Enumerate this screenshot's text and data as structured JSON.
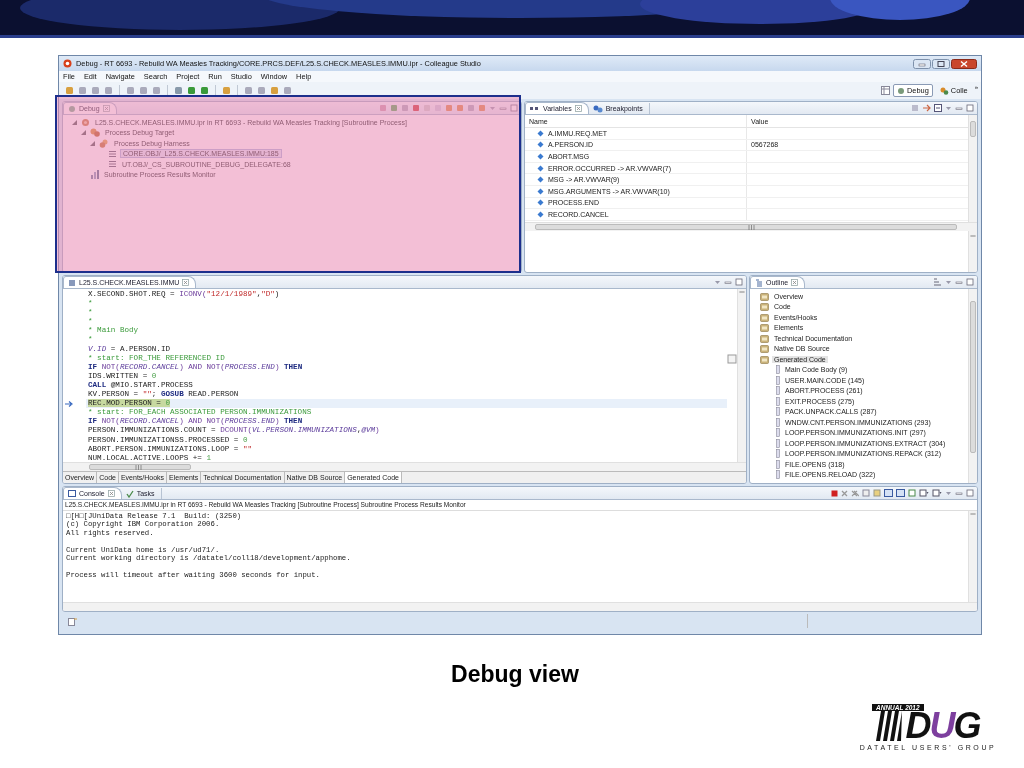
{
  "window": {
    "title": "Debug - RT 6693 - Rebuild WA Measles Tracking/CORE.PRCS.DEF/L25.S.CHECK.MEASLES.IMMU.ipr - Colleague Studio"
  },
  "menu": [
    "File",
    "Edit",
    "Navigate",
    "Search",
    "Project",
    "Run",
    "Studio",
    "Window",
    "Help"
  ],
  "perspectives": [
    {
      "label": "Debug",
      "selected": true
    },
    {
      "label": "Colle",
      "selected": false
    }
  ],
  "perspective_overflow": "»",
  "debug_view": {
    "tab": "Debug",
    "tree": [
      {
        "label": "L25.S.CHECK.MEASLES.IMMU.ipr in RT 6693 - Rebuild WA Measles Tracking [Subroutine Process]",
        "kind": "launch",
        "expanded": true,
        "selected": false,
        "children": [
          {
            "label": "Process Debug Target",
            "kind": "target",
            "expanded": true,
            "selected": false,
            "children": [
              {
                "label": "Process Debug Harness",
                "kind": "harness",
                "expanded": true,
                "selected": false,
                "children": [
                  {
                    "label": "CORE.OBJ/_L25.S.CHECK.MEASLES.IMMU:185",
                    "kind": "frame",
                    "selected": true
                  },
                  {
                    "label": "UT.OBJ/_CS_SUBROUTINE_DEBUG_DELEGATE:68",
                    "kind": "frame",
                    "selected": false
                  }
                ]
              }
            ]
          },
          {
            "label": "Subroutine Process Results Monitor",
            "kind": "monitor",
            "selected": false
          }
        ]
      }
    ]
  },
  "variables_view": {
    "tabs": [
      {
        "label": "Variables",
        "selected": true
      },
      {
        "label": "Breakpoints",
        "selected": false
      }
    ],
    "columns": [
      "Name",
      "Value"
    ],
    "rows": [
      {
        "name": "A.IMMU.REQ.MET"
      },
      {
        "name": "A.PERSON.ID",
        "value": "0567268"
      },
      {
        "name": "ABORT.MSG"
      },
      {
        "name": "ERROR.OCCURRED -> AR.VWVAR(7)"
      },
      {
        "name": "MSG -> AR.VWVAR(9)"
      },
      {
        "name": "MSG.ARGUMENTS -> AR.VWVAR(10)"
      },
      {
        "name": "PROCESS.END"
      },
      {
        "name": "RECORD.CANCEL"
      }
    ]
  },
  "editor": {
    "tab": "L25.S.CHECK.MEASLES.IMMU",
    "lines": [
      {
        "current": false,
        "segments": [
          {
            "text": "X.SECOND.SHOT.REQ = ",
            "kind": "plain"
          },
          {
            "text": "ICONV(",
            "kind": "func"
          },
          {
            "text": "\"12/1/1989\"",
            "kind": "string"
          },
          {
            "text": ",",
            "kind": "plain"
          },
          {
            "text": "\"D\"",
            "kind": "string"
          },
          {
            "text": ")",
            "kind": "plain"
          }
        ]
      },
      {
        "current": false,
        "segments": [
          {
            "text": "*",
            "kind": "comment"
          }
        ]
      },
      {
        "current": false,
        "segments": [
          {
            "text": "*",
            "kind": "comment"
          }
        ]
      },
      {
        "current": false,
        "segments": [
          {
            "text": "*",
            "kind": "comment"
          }
        ]
      },
      {
        "current": false,
        "segments": [
          {
            "text": "* Main Body",
            "kind": "comment"
          }
        ]
      },
      {
        "current": false,
        "segments": [
          {
            "text": "*",
            "kind": "comment"
          }
        ]
      },
      {
        "current": false,
        "segments": [
          {
            "text": "V.ID",
            "kind": "var"
          },
          {
            "text": " = A.PERSON.ID",
            "kind": "plain"
          }
        ]
      },
      {
        "current": false,
        "segments": [
          {
            "text": "* start: FOR_THE REFERENCED ID",
            "kind": "comment"
          }
        ]
      },
      {
        "current": false,
        "segments": [
          {
            "text": "IF",
            "kind": "keyword"
          },
          {
            "text": " NOT(",
            "kind": "func"
          },
          {
            "text": "RECORD.CANCEL",
            "kind": "var"
          },
          {
            "text": ") AND NOT(",
            "kind": "func"
          },
          {
            "text": "PROCESS.END",
            "kind": "var"
          },
          {
            "text": ")",
            "kind": "func"
          },
          {
            "text": " THEN",
            "kind": "keyword"
          }
        ]
      },
      {
        "current": false,
        "segments": [
          {
            "text": "IDS.WRITTEN = ",
            "kind": "plain"
          },
          {
            "text": "0",
            "kind": "number"
          }
        ]
      },
      {
        "current": false,
        "segments": [
          {
            "text": "CALL",
            "kind": "keyword"
          },
          {
            "text": " @MIO.START.PROCESS",
            "kind": "plain"
          }
        ]
      },
      {
        "current": false,
        "segments": [
          {
            "text": "KV.PERSON = ",
            "kind": "plain"
          },
          {
            "text": "\"\"",
            "kind": "string"
          },
          {
            "text": "; ",
            "kind": "plain"
          },
          {
            "text": "GOSUB",
            "kind": "keyword"
          },
          {
            "text": " READ.PERSON",
            "kind": "plain"
          }
        ]
      },
      {
        "current": true,
        "segments": [
          {
            "text": "REC.MOD.PERSON = ",
            "kind": "plain"
          },
          {
            "text": "0",
            "kind": "number"
          }
        ]
      },
      {
        "current": false,
        "segments": [
          {
            "text": "* start: FOR_EACH ASSOCIATED PERSON.IMMUNIZATIONS",
            "kind": "comment"
          }
        ]
      },
      {
        "current": false,
        "segments": [
          {
            "text": "IF",
            "kind": "keyword"
          },
          {
            "text": " NOT(",
            "kind": "func"
          },
          {
            "text": "RECORD.CANCEL",
            "kind": "var"
          },
          {
            "text": ") AND NOT(",
            "kind": "func"
          },
          {
            "text": "PROCESS.END",
            "kind": "var"
          },
          {
            "text": ")",
            "kind": "func"
          },
          {
            "text": " THEN",
            "kind": "keyword"
          }
        ]
      },
      {
        "current": false,
        "segments": [
          {
            "text": "PERSON.IMMUNIZATIONS.COUNT = ",
            "kind": "plain"
          },
          {
            "text": "DCOUNT(",
            "kind": "func"
          },
          {
            "text": "VL.PERSON.IMMUNIZATIONS",
            "kind": "var"
          },
          {
            "text": ",",
            "kind": "plain"
          },
          {
            "text": "@VM",
            "kind": "var"
          },
          {
            "text": ")",
            "kind": "func"
          }
        ]
      },
      {
        "current": false,
        "segments": [
          {
            "text": "PERSON.IMMUNIZATIONSS.PROCESSED = ",
            "kind": "plain"
          },
          {
            "text": "0",
            "kind": "number"
          }
        ]
      },
      {
        "current": false,
        "segments": [
          {
            "text": "ABORT.PERSON.IMMUNIZATIONS.LOOP = ",
            "kind": "plain"
          },
          {
            "text": "\"\"",
            "kind": "string"
          }
        ]
      },
      {
        "current": false,
        "segments": [
          {
            "text": "NUM.LOCAL.ACTIVE.LOOPS += ",
            "kind": "plain"
          },
          {
            "text": "1",
            "kind": "number"
          }
        ]
      }
    ],
    "bottom_tabs": [
      {
        "label": "Overview",
        "selected": false
      },
      {
        "label": "Code",
        "selected": false
      },
      {
        "label": "Events/Hooks",
        "selected": false
      },
      {
        "label": "Elements",
        "selected": false
      },
      {
        "label": "Technical Documentation",
        "selected": false
      },
      {
        "label": "Native DB Source",
        "selected": false
      },
      {
        "label": "Generated Code",
        "selected": true
      }
    ]
  },
  "outline": {
    "tab": "Outline",
    "items": [
      {
        "label": "Overview",
        "kind": "section",
        "selected": false
      },
      {
        "label": "Code",
        "kind": "section",
        "selected": false
      },
      {
        "label": "Events/Hooks",
        "kind": "section",
        "selected": false
      },
      {
        "label": "Elements",
        "kind": "section",
        "selected": false
      },
      {
        "label": "Technical Documentation",
        "kind": "section",
        "selected": false
      },
      {
        "label": "Native DB Source",
        "kind": "section",
        "selected": false
      },
      {
        "label": "Generated Code",
        "kind": "section",
        "selected": true,
        "children": [
          {
            "label": "Main Code Body (9)",
            "kind": "routine",
            "selected": false
          },
          {
            "label": "USER.MAIN.CODE (145)",
            "kind": "routine",
            "selected": false
          },
          {
            "label": "ABORT.PROCESS (261)",
            "kind": "routine",
            "selected": false
          },
          {
            "label": "EXIT.PROCESS (275)",
            "kind": "routine",
            "selected": false
          },
          {
            "label": "PACK.UNPACK.CALLS (287)",
            "kind": "routine",
            "selected": false
          },
          {
            "label": "WNDW.CNT.PERSON.IMMUNIZATIONS (293)",
            "kind": "routine",
            "selected": false
          },
          {
            "label": "LOOP.PERSON.IMMUNIZATIONS.INIT (297)",
            "kind": "routine",
            "selected": false
          },
          {
            "label": "LOOP.PERSON.IMMUNIZATIONS.EXTRACT (304)",
            "kind": "routine",
            "selected": false
          },
          {
            "label": "LOOP.PERSON.IMMUNIZATIONS.REPACK (312)",
            "kind": "routine",
            "selected": false
          },
          {
            "label": "FILE.OPENS (318)",
            "kind": "routine",
            "selected": false
          },
          {
            "label": "FILE.OPENS.RELOAD (322)",
            "kind": "routine",
            "selected": false
          }
        ]
      }
    ]
  },
  "console": {
    "tabs": [
      {
        "label": "Console",
        "selected": true
      },
      {
        "label": "Tasks",
        "selected": false
      }
    ],
    "description": "L25.S.CHECK.MEASLES.IMMU.ipr in RT 6693 - Rebuild WA Measles Tracking [Subroutine Process] Subroutine Process Results Monitor",
    "paragraphs": [
      [
        "□[H□[JUniData Release 7.1  Build: (3250)",
        "(c) Copyright IBM Corporation 2006.",
        "All rights reserved."
      ],
      [
        "Current UniData home is /usr/ud71/.",
        "Current working directory is /datatel/coll18/development/apphome."
      ],
      [
        "Process will timeout after waiting 3600 seconds for input."
      ]
    ]
  },
  "slide": {
    "caption": "Debug view",
    "logo": {
      "top": "ANNUAL 2012",
      "mark": [
        "D",
        "U",
        "G"
      ],
      "bottom": "DATATEL USERS' GROUP"
    }
  }
}
